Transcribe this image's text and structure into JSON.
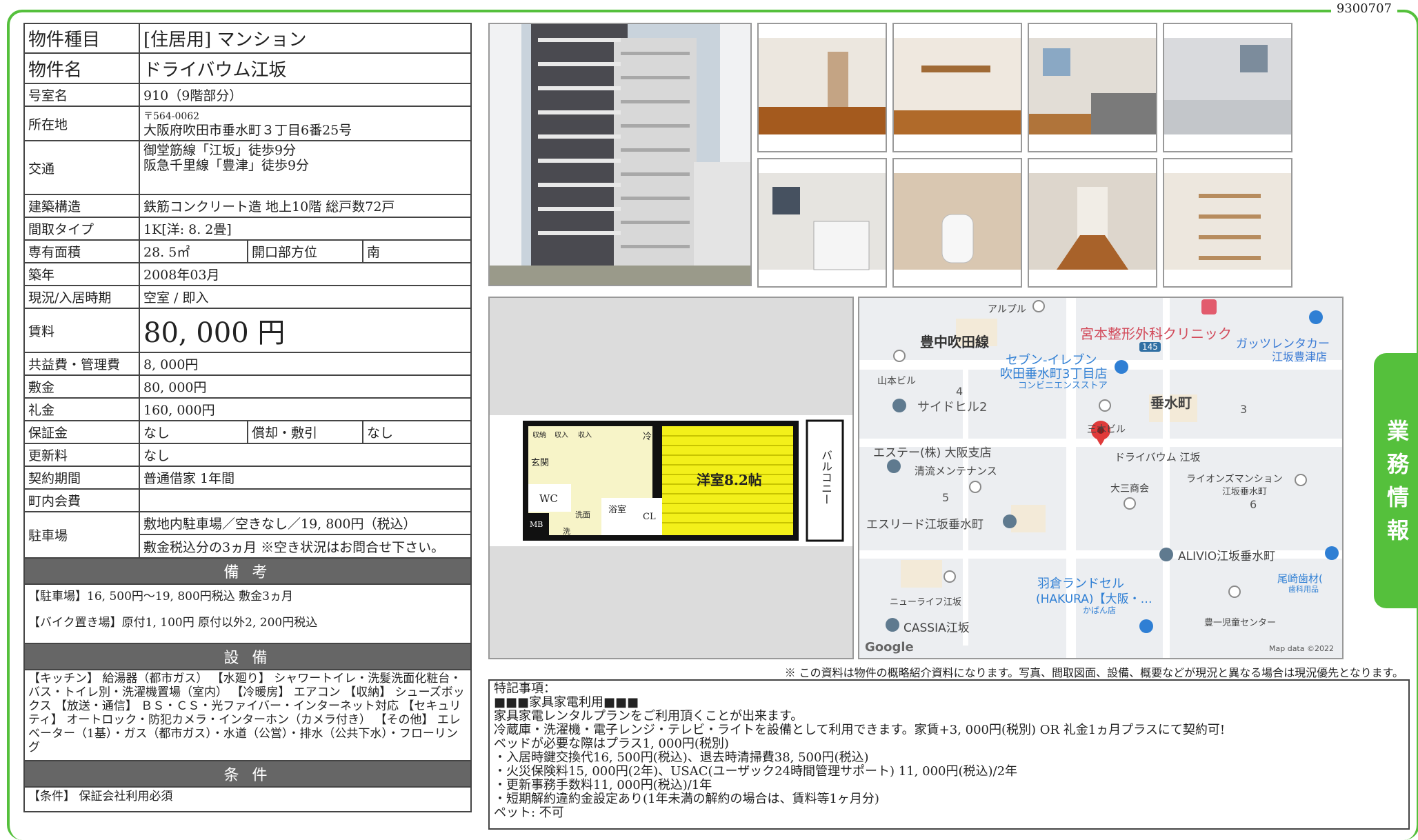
{
  "doc_number": "9300707",
  "side_tab": [
    "業",
    "務",
    "情",
    "報"
  ],
  "property": {
    "type_label": "物件種目",
    "type_value": "[住居用] マンション",
    "name_label": "物件名",
    "name_value": "ドライバウム江坂",
    "room_label": "号室名",
    "room_value": "910（9階部分）",
    "address_label": "所在地",
    "postal": "〒564-0062",
    "address": "大阪府吹田市垂水町３丁目6番25号",
    "transport_label": "交通",
    "transport_1": "御堂筋線「江坂」徒歩9分",
    "transport_2": "阪急千里線「豊津」徒歩9分",
    "structure_label": "建築構造",
    "structure_value": "鉄筋コンクリート造 地上10階 総戸数72戸",
    "layout_label": "間取タイプ",
    "layout_value": "1K[洋: 8. 2畳]",
    "area_label": "専有面積",
    "area_value": "28. 5㎡",
    "orientation_label": "開口部方位",
    "orientation_value": "南",
    "built_label": "築年",
    "built_value": "2008年03月",
    "status_label": "現況/入居時期",
    "status_value": "空室 / 即入",
    "rent_label": "賃料",
    "rent_value": "80, 000 円",
    "fee_label": "共益費・管理費",
    "fee_value": "8, 000円",
    "deposit_label": "敷金",
    "deposit_value": "80, 000円",
    "keymoney_label": "礼金",
    "keymoney_value": "160, 000円",
    "guarantee_label": "保証金",
    "guarantee_value": "なし",
    "amort_label": "償却・敷引",
    "amort_value": "なし",
    "renewal_label": "更新料",
    "renewal_value": "なし",
    "contract_label": "契約期間",
    "contract_value": "普通借家 1年間",
    "association_label": "町内会費",
    "association_value": "",
    "parking_label": "駐車場",
    "parking_1": "敷地内駐車場／空きなし／19, 800円（税込）",
    "parking_2": "敷金税込分の3ヵ月 ※空き状況はお問合せ下さい。"
  },
  "remarks": {
    "title": "備 考",
    "line1": "【駐車場】16, 500円〜19, 800円税込 敷金3ヵ月",
    "line2": "【バイク置き場】原付1, 100円 原付以外2, 200円税込"
  },
  "equipment": {
    "title": "設 備",
    "text": "【キッチン】 給湯器（都市ガス） 【水廻り】 シャワートイレ・洗髪洗面化粧台・バス・トイレ別・洗濯機置場（室内） 【冷暖房】 エアコン 【収納】 シューズボックス 【放送・通信】 ＢＳ・ＣＳ・光ファイバー・インターネット対応 【セキュリティ】 オートロック・防犯カメラ・インターホン（カメラ付き） 【その他】 エレベーター（1基）・ガス（都市ガス）・水道（公営）・排水（公共下水）・フローリング"
  },
  "conditions": {
    "title": "条 件",
    "text": "【条件】 保証会社利用必須"
  },
  "floorplan": {
    "room_label": "洋室8.2帖",
    "balcony": "バルコニー",
    "entrance": "玄関",
    "wc": "WC",
    "mb": "MB",
    "bath": "浴室",
    "cl": "CL",
    "fridge": "冷",
    "wash": "洗面",
    "washer": "洗",
    "shelf_1": "収納",
    "shelf_2": "収入",
    "shelf_3": "収入"
  },
  "map": {
    "labels": [
      "アルプル",
      "豊中吹田線",
      "宮本整形外科クリニック",
      "ガッツレンタカー",
      "江坂豊津店",
      "145",
      "セブン-イレブン",
      "吹田垂水町3丁目店",
      "コンビニエンスストア",
      "山本ビル",
      "4",
      "サイドヒル2",
      "垂水町",
      "3",
      "三木ビル",
      "エステー(株) 大阪支店",
      "清流メンテナンス",
      "ドライバウム 江坂",
      "ライオンズマンション",
      "江坂垂水町",
      "大三商会",
      "5",
      "6",
      "エスリード江坂垂水町",
      "ALIVIO江坂垂水町",
      "羽倉ランドセル",
      "(HAKURA)【大阪・…",
      "かばん店",
      "尾崎歯材(",
      "歯科用品",
      "ニューライフ江坂",
      "豊一児童センター",
      "CASSIA江坂",
      "Google",
      "Map data ©2022"
    ]
  },
  "notice": "※ この資料は物件の概略紹介資料になります。写真、間取図面、設備、概要などが現況と異なる場合は現況優先となります。",
  "special": {
    "title": "特記事項：",
    "lines": [
      "■■■家具家電利用■■■",
      "家具家電レンタルプランをご利用頂くことが出来ます。",
      "冷蔵庫・洗濯機・電子レンジ・テレビ・ライトを設備として利用できます。家賃+3, 000円(税別) OR 礼金1ヵ月プラスにて契約可!",
      "ベッドが必要な際はプラス1, 000円(税別)",
      "・入居時鍵交換代16, 500円(税込)、退去時清掃費38, 500円(税込)",
      "・火災保険料15, 000円(2年)、USAC(ユーザック24時間管理サポート) 11, 000円(税込)/2年",
      "・更新事務手数料11, 000円(税込)/1年",
      "・短期解約違約金設定あり(1年未満の解約の場合は、賃料等1ヶ月分)",
      "ペット: 不可"
    ]
  },
  "colors": {
    "frame": "#55c03c",
    "section": "#666666",
    "plan_room": "#f3f01a",
    "map_pin": "#e03a3a"
  }
}
